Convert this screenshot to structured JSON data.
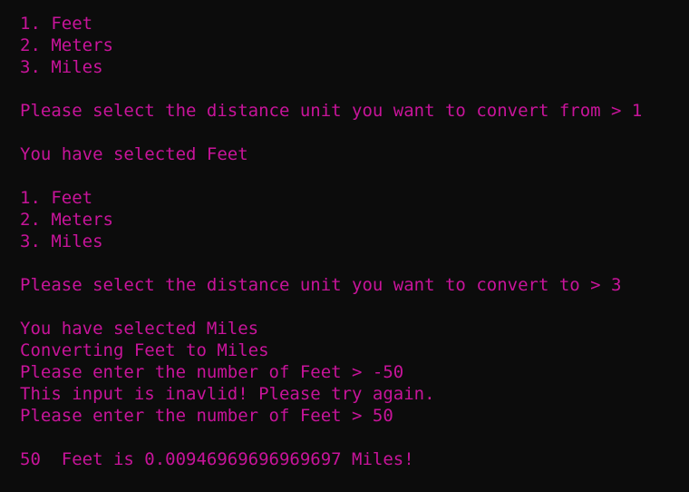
{
  "terminal": {
    "text_color": "#c8149a",
    "background_color": "#0c0c0c",
    "menu_from": {
      "item1": "1. Feet",
      "item2": "2. Meters",
      "item3": "3. Miles"
    },
    "prompt_from": "Please select the distance unit you want to convert from > 1",
    "selected_from": "You have selected Feet",
    "menu_to": {
      "item1": "1. Feet",
      "item2": "2. Meters",
      "item3": "3. Miles"
    },
    "prompt_to": "Please select the distance unit you want to convert to > 3",
    "selected_to": "You have selected Miles",
    "converting": "Converting Feet to Miles",
    "enter_number_1": "Please enter the number of Feet > -50",
    "invalid_msg": "This input is inavlid! Please try again.",
    "enter_number_2": "Please enter the number of Feet > 50",
    "result": "50  Feet is 0.00946969696969697 Miles!"
  }
}
